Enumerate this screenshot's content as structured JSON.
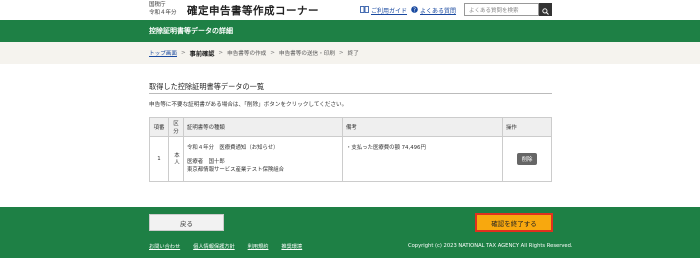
{
  "header": {
    "agency_line1": "国税庁",
    "agency_line2": "令和４年分",
    "site_title": "確定申告書等作成コーナー",
    "guide_link": "ご利用ガイド",
    "faq_link": "よくある質問",
    "search_placeholder": "よくある質問を検索"
  },
  "page_title": "控除証明書等データの詳細",
  "breadcrumb": {
    "top": "トップ画面",
    "current": "事前確認",
    "step2": "申告書等の作成",
    "step3": "申告書等の送信・印刷",
    "step4": "終了",
    "sep": ">"
  },
  "main": {
    "section_title": "取得した控除証明書等データの一覧",
    "description": "申告等に不要な証明書がある場合は、「削除」ボタンをクリックしてください。",
    "table": {
      "headers": [
        "項番",
        "区分",
        "証明書等の種類",
        "備考",
        "操作"
      ],
      "rows": [
        {
          "num": "1",
          "kbn": "本人",
          "kind_line1": "令和４年分　医療費通知（お知らせ）",
          "kind_line2": "医療者　国十郎",
          "kind_line3": "東京都情報サービス産業テスト保険組合",
          "note": "・支払った医療費の額 74,496円",
          "action": "削除"
        }
      ]
    }
  },
  "footer": {
    "back_label": "戻る",
    "finish_label": "確認を終了する",
    "links": [
      "お問い合わせ",
      "個人情報保護方針",
      "利用規約",
      "推奨環境"
    ],
    "copyright": "Copyright (c) 2023 NATIONAL TAX AGENCY All Rights Reserved."
  },
  "colors": {
    "brand_green": "#1e8045",
    "finish_button": "#f8a80e",
    "finish_border": "#e0301e"
  }
}
